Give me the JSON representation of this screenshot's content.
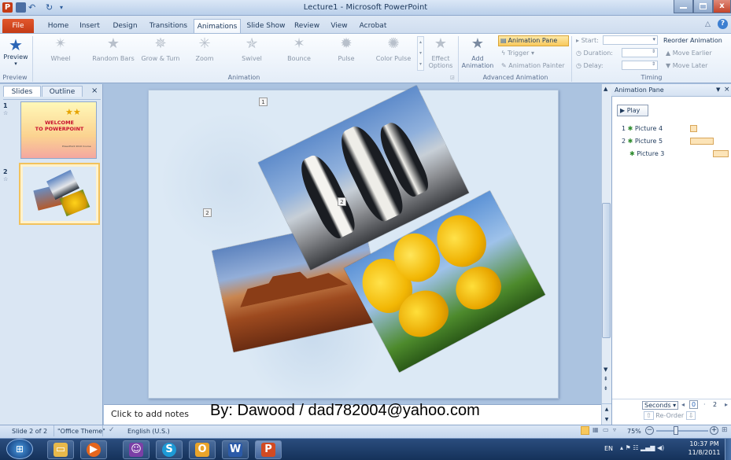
{
  "window": {
    "title": "Lecture1 - Microsoft PowerPoint",
    "app_icon_letter": "P"
  },
  "tabs": [
    "File",
    "Home",
    "Insert",
    "Design",
    "Transitions",
    "Animations",
    "Slide Show",
    "Review",
    "View",
    "Acrobat"
  ],
  "ribbon": {
    "preview": {
      "label": "Preview",
      "group": "Preview"
    },
    "animation_gallery": [
      "Wheel",
      "Random Bars",
      "Grow & Turn",
      "Zoom",
      "Swivel",
      "Bounce",
      "Pulse",
      "Color Pulse"
    ],
    "animation_group_label": "Animation",
    "effect_options": {
      "line1": "Effect",
      "line2": "Options"
    },
    "add_animation": {
      "line1": "Add",
      "line2": "Animation"
    },
    "animation_pane_btn": "Animation Pane",
    "trigger_btn": "Trigger",
    "animation_painter_btn": "Animation Painter",
    "advanced_group_label": "Advanced Animation",
    "start_label": "Start:",
    "duration_label": "Duration:",
    "delay_label": "Delay:",
    "reorder_title": "Reorder Animation",
    "move_earlier": "Move Earlier",
    "move_later": "Move Later",
    "timing_group_label": "Timing"
  },
  "left_panel": {
    "tabs": [
      "Slides",
      "Outline"
    ],
    "close_glyph": "×",
    "slides": [
      {
        "number": "1",
        "title_line1": "WELCOME",
        "title_line2": "TO POWERPOINT",
        "footer": "PowerPoint  2010 Course"
      },
      {
        "number": "2"
      }
    ]
  },
  "slide": {
    "tags": [
      "1",
      "2",
      "2"
    ]
  },
  "notes": {
    "placeholder": "Click to add notes",
    "overlay_text": "By: Dawood / dad782004@yahoo.com"
  },
  "animation_pane": {
    "title": "Animation Pane",
    "play_label": "Play",
    "items": [
      {
        "index": "1",
        "name": "Picture 4"
      },
      {
        "index": "2",
        "name": "Picture 5"
      },
      {
        "index": "",
        "name": "Picture 3"
      }
    ],
    "seconds_label": "Seconds",
    "scale": [
      "0",
      "2"
    ],
    "reorder_label": "Re-Order"
  },
  "status": {
    "slide_info": "Slide 2 of 2",
    "theme": "\"Office Theme\"",
    "language": "English (U.S.)",
    "zoom": "75%"
  },
  "taskbar": {
    "lang": "EN",
    "time": "10:37 PM",
    "date": "11/8/2011"
  },
  "colors": {
    "file_tab": "#d24a22",
    "accent_blue": "#1e395b",
    "highlight": "#fce4b8"
  }
}
